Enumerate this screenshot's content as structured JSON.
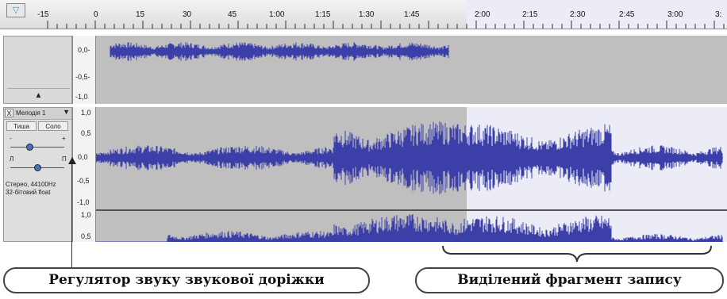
{
  "ruler": {
    "ticks": [
      "-15",
      "0",
      "15",
      "30",
      "45",
      "1:00",
      "1:15",
      "1:30",
      "1:45",
      "2:00",
      "2:15",
      "2:30",
      "2:45",
      "3:00",
      "3:"
    ],
    "selection_start_label": "2:00"
  },
  "track1": {
    "scale_labels": [
      "0,0-",
      "-0,5-",
      "-1,0"
    ],
    "collapse_icon": "triangle-up-icon"
  },
  "track2": {
    "name": "Мелодія 1",
    "close_label": "X",
    "menu_icon": "triangle-down-icon",
    "mute_label": "Тиша",
    "solo_label": "Соло",
    "gain_minus": "-",
    "gain_plus": "+",
    "pan_left": "Л",
    "pan_right": "П",
    "info_line1": "Стерео, 44100Hz",
    "info_line2": "32-бітовий float",
    "scale_labels": [
      "1,0",
      "0,5",
      "0,0",
      "-0,5",
      "-1,0",
      "1,0",
      "0,5"
    ]
  },
  "annotations": {
    "left_callout": "Регулятор звуку звукової доріжки",
    "right_callout": "Виділений фрагмент запису"
  },
  "colors": {
    "waveform": "#3d3fa8",
    "selection": "#ececf6",
    "track_bg": "#bfbfbf"
  }
}
